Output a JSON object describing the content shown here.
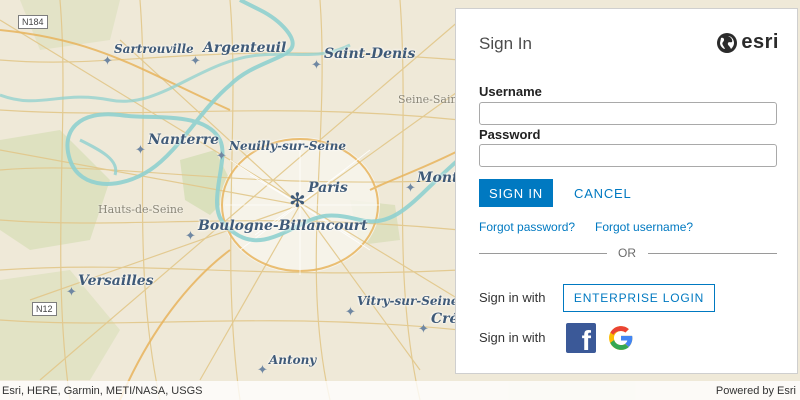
{
  "map": {
    "cities": [
      {
        "key": "sartrouville",
        "name": "Sartrouville",
        "small": true
      },
      {
        "key": "argenteuil",
        "name": "Argenteuil",
        "small": false
      },
      {
        "key": "saint_denis",
        "name": "Saint-Denis",
        "small": false
      },
      {
        "key": "nanterre",
        "name": "Nanterre",
        "small": false
      },
      {
        "key": "neuilly",
        "name": "Neuilly-sur-Seine",
        "small": true
      },
      {
        "key": "paris",
        "name": "Paris",
        "small": false
      },
      {
        "key": "montreuil",
        "name": "Montr",
        "small": false
      },
      {
        "key": "boulogne",
        "name": "Boulogne-Billancourt",
        "small": false
      },
      {
        "key": "versailles",
        "name": "Versailles",
        "small": false
      },
      {
        "key": "vitry",
        "name": "Vitry-sur-Seine",
        "small": true
      },
      {
        "key": "creteil",
        "name": "Cré",
        "small": false
      },
      {
        "key": "antony",
        "name": "Antony",
        "small": true
      }
    ],
    "regions": {
      "seine_saint": "Seine-Sain",
      "hauts_de_seine": "Hauts-de-Seine"
    },
    "road_shields": {
      "n184": "N184",
      "n12": "N12"
    },
    "attribution": "Esri, HERE, Garmin, METI/NASA, USGS",
    "powered_by": "Powered by Esri"
  },
  "signin": {
    "title": "Sign In",
    "logo_text": "esri",
    "logo_icon": "globe-icon",
    "username_label": "Username",
    "username_value": "",
    "password_label": "Password",
    "password_value": "",
    "signin_button": "SIGN IN",
    "cancel_button": "CANCEL",
    "forgot_password": "Forgot password?",
    "forgot_username": "Forgot username?",
    "or_text": "OR",
    "sign_in_with_1": "Sign in with",
    "enterprise_button": "ENTERPRISE LOGIN",
    "sign_in_with_2": "Sign in with",
    "facebook_icon": "facebook-icon",
    "google_icon": "google-icon"
  },
  "colors": {
    "accent": "#0079c1",
    "facebook": "#3b5998",
    "map_land": "#efe9d8",
    "map_water": "#8fd0cf",
    "map_park": "#d7ddb6"
  }
}
